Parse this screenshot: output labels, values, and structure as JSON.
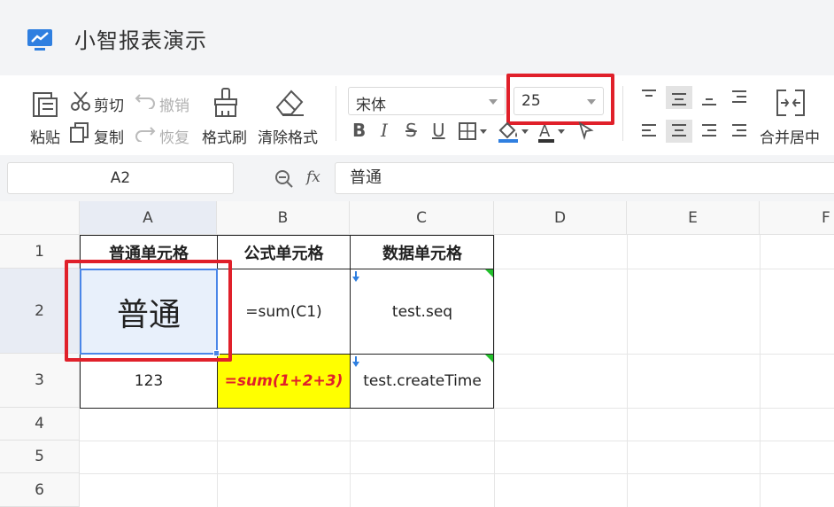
{
  "app": {
    "title": "小智报表演示"
  },
  "toolbar": {
    "paste": "粘贴",
    "cut": "剪切",
    "copy": "复制",
    "undo": "撤销",
    "redo": "恢复",
    "format_painter": "格式刷",
    "clear_format": "清除格式",
    "font_family": "宋体",
    "font_size": "25",
    "bold": "B",
    "italic": "I",
    "strike": "S",
    "underline": "U",
    "merge_center": "合并居中"
  },
  "formula_bar": {
    "cell_ref": "A2",
    "fx": "fx",
    "value": "普通"
  },
  "grid": {
    "columns": [
      "A",
      "B",
      "C",
      "D",
      "E",
      "F"
    ],
    "rows": [
      "1",
      "2",
      "3",
      "4",
      "5",
      "6"
    ],
    "cells": {
      "A1": "普通单元格",
      "B1": "公式单元格",
      "C1": "数据单元格",
      "A2": "普通",
      "B2": "=sum(C1)",
      "C2": "test.seq",
      "A3": "123",
      "B3": "=sum(1+2+3)",
      "C3": "test.createTime"
    }
  },
  "colors": {
    "highlight": "#e0202a",
    "selection": "#4a86e8",
    "formula_fill": "#ffff00",
    "formula_text": "#e0202a",
    "data_marker": "#22c02b"
  }
}
